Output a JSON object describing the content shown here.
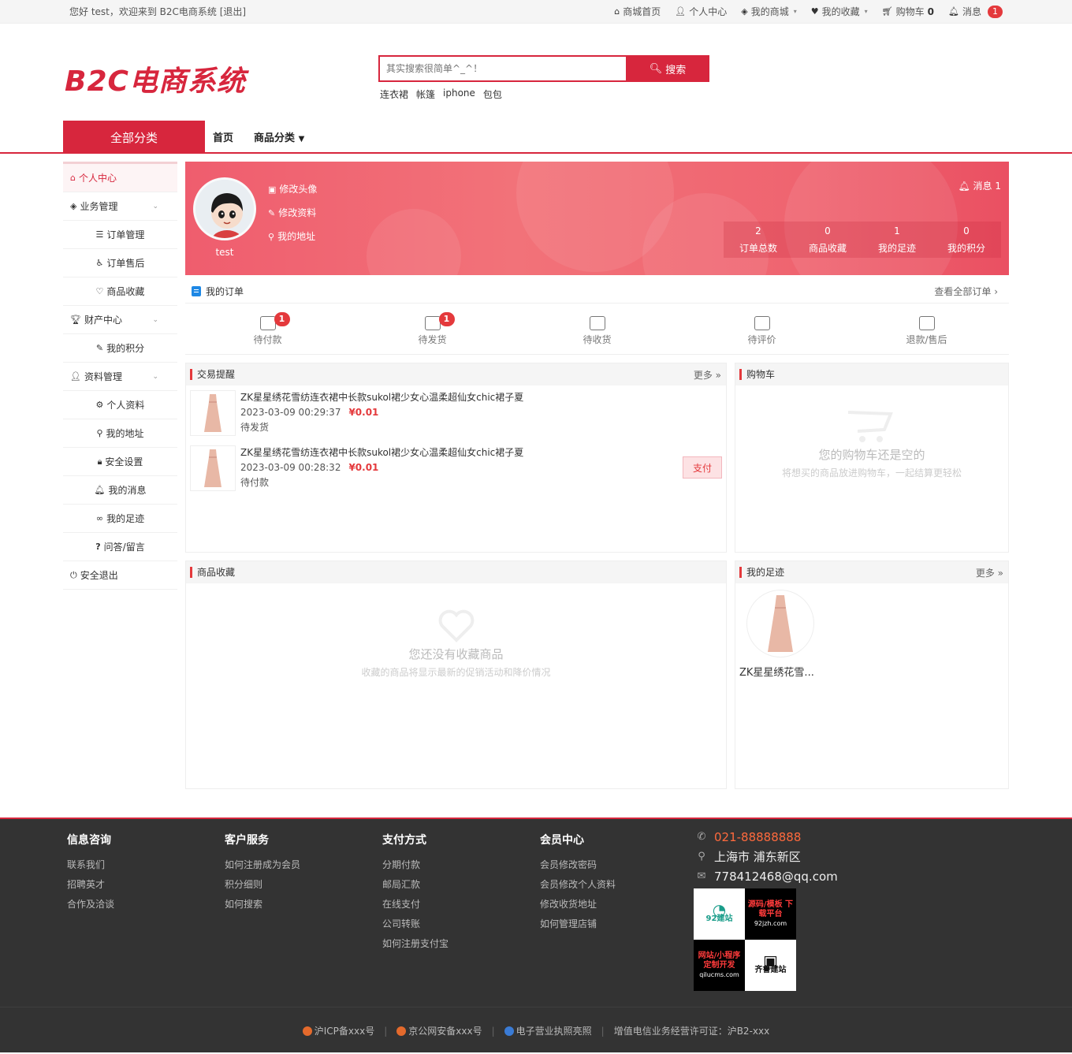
{
  "topbar": {
    "welcome": "您好 test，欢迎来到 B2C电商系统 [退出]",
    "links": [
      {
        "icon": "home-icon",
        "label": "商城首页"
      },
      {
        "icon": "user-icon",
        "label": "个人中心"
      },
      {
        "icon": "cube-icon",
        "label": "我的商城"
      },
      {
        "icon": "heart-icon",
        "label": "我的收藏"
      },
      {
        "icon": "cart-icon",
        "label": "购物车"
      },
      {
        "icon": "bell-icon",
        "label": "消息"
      }
    ],
    "cart_count": "0",
    "msg_count": "1"
  },
  "header": {
    "logo": "B2C电商系统",
    "search_placeholder": "其实搜索很简单^_^！",
    "search_button": "搜索",
    "hot_words": [
      "连衣裙",
      "帐篷",
      "iphone",
      "包包"
    ]
  },
  "nav": {
    "all_categories": "全部分类",
    "home": "首页",
    "goods_category": "商品分类"
  },
  "sidebar": {
    "items": [
      {
        "label": "个人中心",
        "icon": "home-icon"
      },
      {
        "label": "业务管理",
        "icon": "cube-icon"
      },
      {
        "label": "订单管理",
        "icon": "list-icon"
      },
      {
        "label": "订单售后",
        "icon": "wheelchair-icon"
      },
      {
        "label": "商品收藏",
        "icon": "heart-icon"
      },
      {
        "label": "财产中心",
        "icon": "trophy-icon"
      },
      {
        "label": "我的积分",
        "icon": "pen-icon"
      },
      {
        "label": "资料管理",
        "icon": "user-icon"
      },
      {
        "label": "个人资料",
        "icon": "gear-icon"
      },
      {
        "label": "我的地址",
        "icon": "pin-icon"
      },
      {
        "label": "安全设置",
        "icon": "lock-icon"
      },
      {
        "label": "我的消息",
        "icon": "bell-icon"
      },
      {
        "label": "我的足迹",
        "icon": "footprint-icon"
      },
      {
        "label": "问答/留言",
        "icon": "question-icon"
      },
      {
        "label": "安全退出",
        "icon": "power-icon"
      }
    ]
  },
  "profile": {
    "username": "test",
    "links": [
      "修改头像",
      "修改资料",
      "我的地址"
    ],
    "message": "消息 1",
    "stats": [
      {
        "value": "2",
        "label": "订单总数"
      },
      {
        "value": "0",
        "label": "商品收藏"
      },
      {
        "value": "1",
        "label": "我的足迹"
      },
      {
        "value": "0",
        "label": "我的积分"
      }
    ]
  },
  "orders": {
    "title": "我的订单",
    "view_all": "查看全部订单",
    "statuses": [
      {
        "label": "待付款",
        "badge": "1"
      },
      {
        "label": "待发货",
        "badge": "1"
      },
      {
        "label": "待收货",
        "badge": ""
      },
      {
        "label": "待评价",
        "badge": ""
      },
      {
        "label": "退款/售后",
        "badge": ""
      }
    ]
  },
  "trade": {
    "title": "交易提醒",
    "more": "更多",
    "rows": [
      {
        "name": "ZK星星绣花雪纺连衣裙中长款sukol裙少女心温柔超仙女chic裙子夏",
        "time": "2023-03-09 00:29:37",
        "price": "¥0.01",
        "status": "待发货",
        "action": ""
      },
      {
        "name": "ZK星星绣花雪纺连衣裙中长款sukol裙少女心温柔超仙女chic裙子夏",
        "time": "2023-03-09 00:28:32",
        "price": "¥0.01",
        "status": "待付款",
        "action": "支付"
      }
    ]
  },
  "cart": {
    "title": "购物车",
    "empty_title": "您的购物车还是空的",
    "empty_sub": "将想买的商品放进购物车，一起结算更轻松"
  },
  "favorites": {
    "title": "商品收藏",
    "empty_title": "您还没有收藏商品",
    "empty_sub": "收藏的商品将显示最新的促销活动和降价情况"
  },
  "footprint": {
    "title": "我的足迹",
    "more": "更多",
    "item": "ZK星星绣花雪..."
  },
  "footer": {
    "cols": [
      {
        "title": "信息咨询",
        "links": [
          "联系我们",
          "招聘英才",
          "合作及洽谈"
        ]
      },
      {
        "title": "客户服务",
        "links": [
          "如何注册成为会员",
          "积分细则",
          "如何搜索"
        ]
      },
      {
        "title": "支付方式",
        "links": [
          "分期付款",
          "邮局汇款",
          "在线支付",
          "公司转账",
          "如何注册支付宝"
        ]
      },
      {
        "title": "会员中心",
        "links": [
          "会员修改密码",
          "会员修改个人资料",
          "修改收货地址",
          "如何管理店铺"
        ]
      }
    ],
    "phone": "021-88888888",
    "address": "上海市 浦东新区",
    "email": "778412468@qq.com",
    "qr": [
      {
        "main": "92建站",
        "sub": ""
      },
      {
        "main": "源码/模板 下载平台",
        "sub": "92jzh.com"
      },
      {
        "main": "网站/小程序 定制开发",
        "sub": "qilucms.com"
      },
      {
        "main": "齐鲁建站",
        "sub": ""
      }
    ],
    "bottom": [
      "沪ICP备xxx号",
      "京公网安备xxx号",
      "电子营业执照亮照",
      "增值电信业务经营许可证：沪B2-xxx"
    ]
  }
}
